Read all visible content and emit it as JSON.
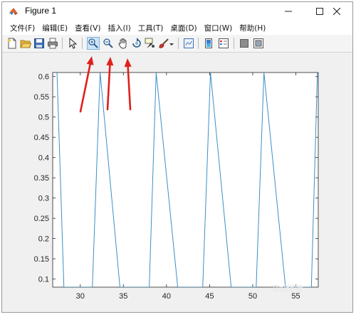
{
  "window": {
    "title": "Figure 1",
    "controls": {
      "minimize": "minimize",
      "maximize": "maximize",
      "close": "close"
    }
  },
  "menu": {
    "items": [
      "文件(F)",
      "编辑(E)",
      "查看(V)",
      "插入(I)",
      "工具(T)",
      "桌面(D)",
      "窗口(W)",
      "帮助(H)"
    ]
  },
  "toolbar": {
    "buttons": [
      {
        "name": "new-figure-button",
        "icon": "new-file-icon"
      },
      {
        "name": "open-file-button",
        "icon": "open-folder-icon"
      },
      {
        "name": "save-button",
        "icon": "save-disk-icon"
      },
      {
        "name": "print-button",
        "icon": "printer-icon"
      },
      {
        "name": "edit-plot-button",
        "icon": "pointer-arrow-icon"
      },
      {
        "name": "zoom-in-button",
        "icon": "zoom-in-icon"
      },
      {
        "name": "zoom-out-button",
        "icon": "zoom-out-icon"
      },
      {
        "name": "pan-button",
        "icon": "hand-icon"
      },
      {
        "name": "rotate-3d-button",
        "icon": "rotate-icon"
      },
      {
        "name": "data-cursor-button",
        "icon": "data-cursor-icon"
      },
      {
        "name": "brush-button",
        "icon": "brush-icon"
      },
      {
        "name": "link-plot-button",
        "icon": "link-plot-icon"
      },
      {
        "name": "insert-colorbar-button",
        "icon": "colorbar-icon"
      },
      {
        "name": "insert-legend-button",
        "icon": "legend-icon"
      },
      {
        "name": "hide-plot-tools-button",
        "icon": "hide-tools-icon"
      },
      {
        "name": "show-plot-tools-button",
        "icon": "show-tools-icon"
      }
    ]
  },
  "annotation": {
    "arrow_color": "#e0201b"
  },
  "chart_data": {
    "type": "line",
    "title": "",
    "xlabel": "",
    "ylabel": "",
    "xlim": [
      26.8,
      57.6
    ],
    "ylim": [
      0.08,
      0.61
    ],
    "x_ticks": [
      30,
      35,
      40,
      45,
      50,
      55
    ],
    "y_ticks": [
      0.1,
      0.15,
      0.2,
      0.25,
      0.3,
      0.35,
      0.4,
      0.45,
      0.5,
      0.55,
      0.6
    ],
    "x_tick_labels": [
      "30",
      "35",
      "40",
      "45",
      "50",
      "55"
    ],
    "y_tick_labels": [
      "0.1",
      "0.15",
      "0.2",
      "0.25",
      "0.3",
      "0.35",
      "0.4",
      "0.45",
      "0.5",
      "0.55",
      "0.6"
    ],
    "grid": false,
    "series": [
      {
        "color": "#3b8fc4",
        "x": [
          27.3,
          28.1,
          31.4,
          32.3,
          34.6,
          38.0,
          38.8,
          41.3,
          44.2,
          45.1,
          47.5,
          50.4,
          51.3,
          53.8,
          56.8,
          57.5
        ],
        "y": [
          0.61,
          0.08,
          0.08,
          0.61,
          0.08,
          0.08,
          0.61,
          0.08,
          0.08,
          0.61,
          0.08,
          0.08,
          0.61,
          0.08,
          0.08,
          0.61
        ]
      }
    ]
  },
  "watermark": {
    "text": "Bai经验"
  }
}
